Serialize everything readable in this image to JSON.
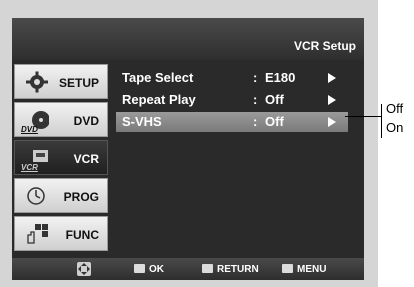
{
  "header": {
    "title": "VCR Setup"
  },
  "sidebar": {
    "items": [
      {
        "label": "SETUP",
        "icon": "gear-icon",
        "active": false
      },
      {
        "label": "DVD",
        "icon": "dvd-disc-icon",
        "icon_text": "DVD",
        "active": false
      },
      {
        "label": "VCR",
        "icon": "vcr-tape-icon",
        "icon_text": "VCR",
        "active": true
      },
      {
        "label": "PROG",
        "icon": "clock-icon",
        "active": false
      },
      {
        "label": "FUNC",
        "icon": "hand-menu-icon",
        "active": false
      }
    ]
  },
  "menu": {
    "rows": [
      {
        "name": "Tape Select",
        "value": "E180",
        "selected": false
      },
      {
        "name": "Repeat Play",
        "value": "Off",
        "selected": false
      },
      {
        "name": "S-VHS",
        "value": "Off",
        "selected": true
      }
    ]
  },
  "footer": {
    "ok_label": "OK",
    "return_label": "RETURN",
    "menu_label": "MENU"
  },
  "options": {
    "off": "Off",
    "on": "On"
  },
  "colors": {
    "background": "#2a2a2a",
    "highlight": "#8a8a8a",
    "text": "#ffffff"
  }
}
